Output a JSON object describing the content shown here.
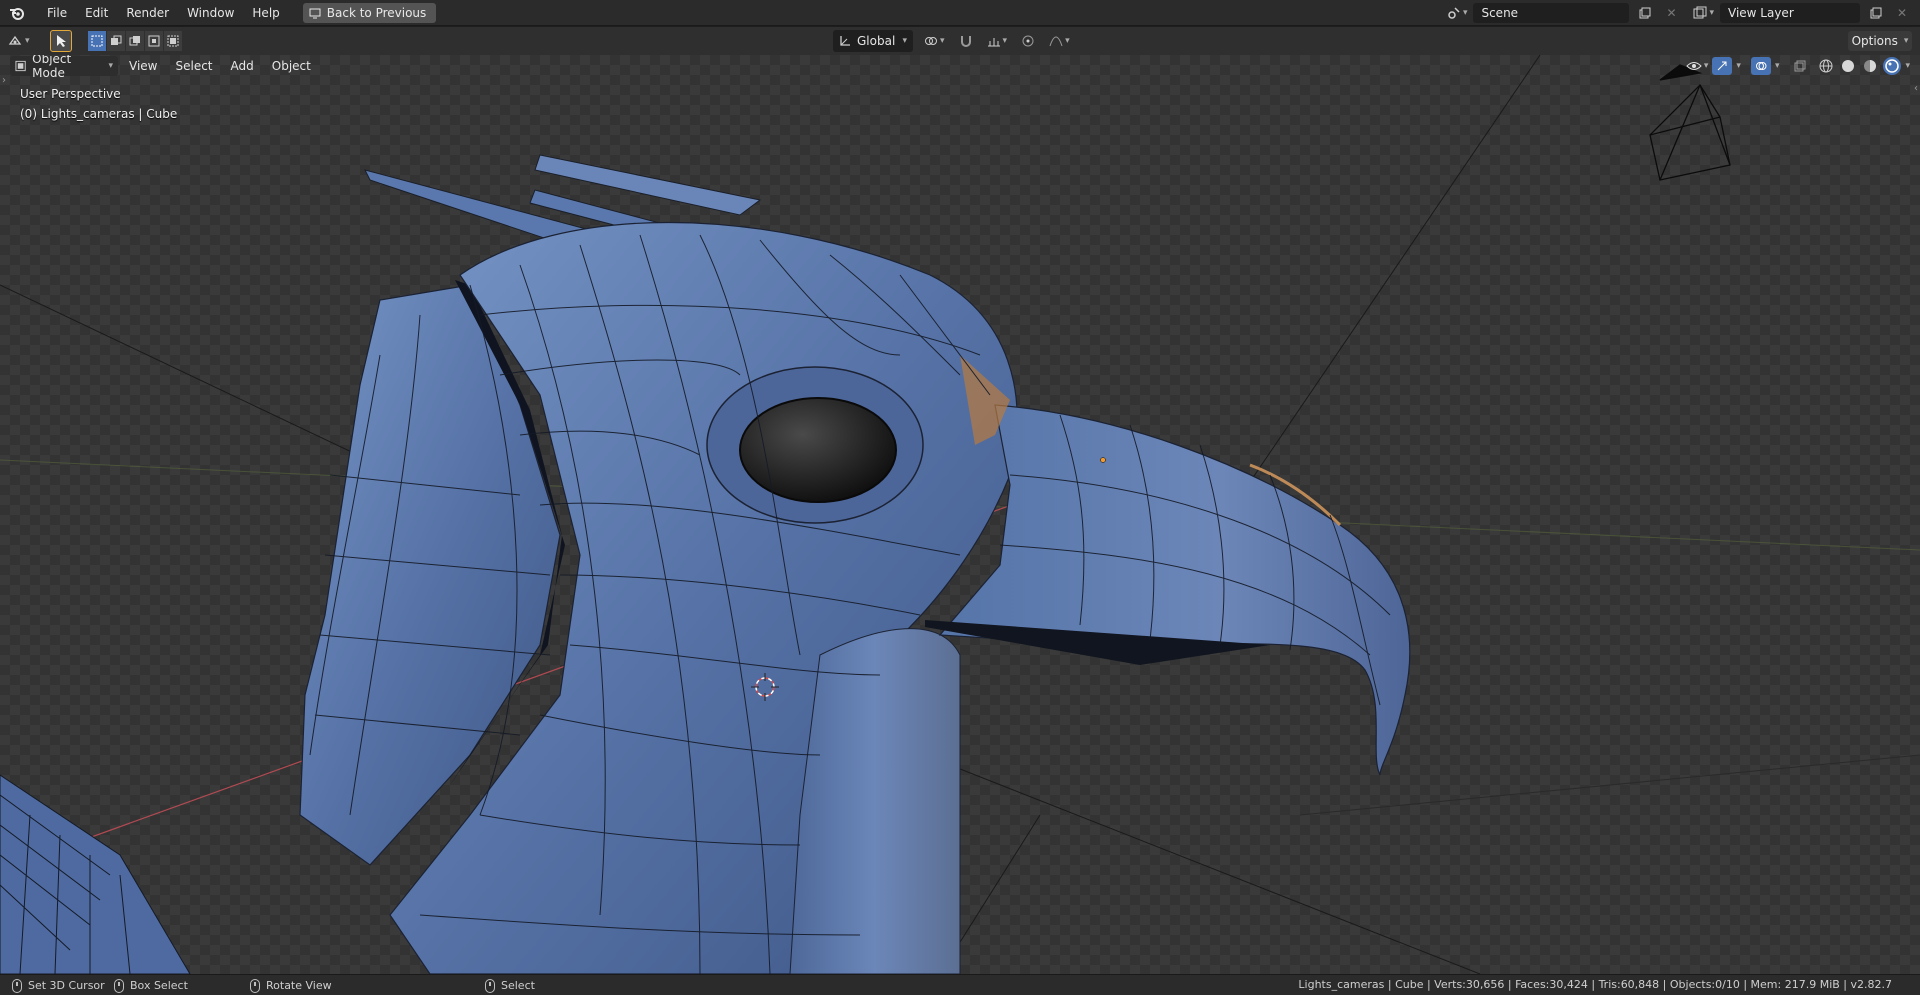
{
  "topbar": {
    "menus": [
      "File",
      "Edit",
      "Render",
      "Window",
      "Help"
    ],
    "back_button": "Back to Previous",
    "scene": "Scene",
    "view_layer": "View Layer"
  },
  "toolheader": {
    "orientation": "Global",
    "options": "Options"
  },
  "viewport": {
    "mode": "Object Mode",
    "menus": [
      "View",
      "Select",
      "Add",
      "Object"
    ],
    "perspective": "User Perspective",
    "collection_info": "(0) Lights_cameras | Cube"
  },
  "statusbar": {
    "set_cursor": "Set 3D Cursor",
    "box_select": "Box Select",
    "rotate_view": "Rotate View",
    "select": "Select",
    "stats": "Lights_cameras | Cube | Verts:30,656 | Faces:30,424 | Tris:60,848 | Objects:0/10 | Mem: 217.9 MiB | v2.82.7"
  },
  "colors": {
    "accent": "#4772b3",
    "mesh": "#5a78ad",
    "active_outline": "#e3a83a"
  }
}
